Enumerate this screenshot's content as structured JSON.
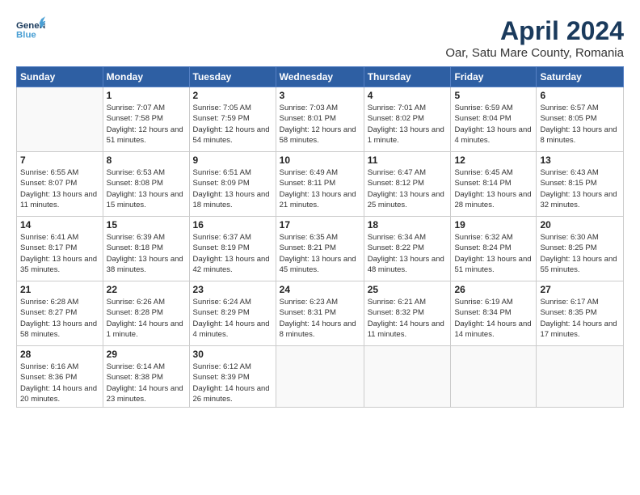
{
  "header": {
    "logo_general": "General",
    "logo_blue": "Blue",
    "title": "April 2024",
    "subtitle": "Oar, Satu Mare County, Romania"
  },
  "days_of_week": [
    "Sunday",
    "Monday",
    "Tuesday",
    "Wednesday",
    "Thursday",
    "Friday",
    "Saturday"
  ],
  "weeks": [
    [
      {
        "day": "",
        "sunrise": "",
        "sunset": "",
        "daylight": ""
      },
      {
        "day": "1",
        "sunrise": "Sunrise: 7:07 AM",
        "sunset": "Sunset: 7:58 PM",
        "daylight": "Daylight: 12 hours and 51 minutes."
      },
      {
        "day": "2",
        "sunrise": "Sunrise: 7:05 AM",
        "sunset": "Sunset: 7:59 PM",
        "daylight": "Daylight: 12 hours and 54 minutes."
      },
      {
        "day": "3",
        "sunrise": "Sunrise: 7:03 AM",
        "sunset": "Sunset: 8:01 PM",
        "daylight": "Daylight: 12 hours and 58 minutes."
      },
      {
        "day": "4",
        "sunrise": "Sunrise: 7:01 AM",
        "sunset": "Sunset: 8:02 PM",
        "daylight": "Daylight: 13 hours and 1 minute."
      },
      {
        "day": "5",
        "sunrise": "Sunrise: 6:59 AM",
        "sunset": "Sunset: 8:04 PM",
        "daylight": "Daylight: 13 hours and 4 minutes."
      },
      {
        "day": "6",
        "sunrise": "Sunrise: 6:57 AM",
        "sunset": "Sunset: 8:05 PM",
        "daylight": "Daylight: 13 hours and 8 minutes."
      }
    ],
    [
      {
        "day": "7",
        "sunrise": "Sunrise: 6:55 AM",
        "sunset": "Sunset: 8:07 PM",
        "daylight": "Daylight: 13 hours and 11 minutes."
      },
      {
        "day": "8",
        "sunrise": "Sunrise: 6:53 AM",
        "sunset": "Sunset: 8:08 PM",
        "daylight": "Daylight: 13 hours and 15 minutes."
      },
      {
        "day": "9",
        "sunrise": "Sunrise: 6:51 AM",
        "sunset": "Sunset: 8:09 PM",
        "daylight": "Daylight: 13 hours and 18 minutes."
      },
      {
        "day": "10",
        "sunrise": "Sunrise: 6:49 AM",
        "sunset": "Sunset: 8:11 PM",
        "daylight": "Daylight: 13 hours and 21 minutes."
      },
      {
        "day": "11",
        "sunrise": "Sunrise: 6:47 AM",
        "sunset": "Sunset: 8:12 PM",
        "daylight": "Daylight: 13 hours and 25 minutes."
      },
      {
        "day": "12",
        "sunrise": "Sunrise: 6:45 AM",
        "sunset": "Sunset: 8:14 PM",
        "daylight": "Daylight: 13 hours and 28 minutes."
      },
      {
        "day": "13",
        "sunrise": "Sunrise: 6:43 AM",
        "sunset": "Sunset: 8:15 PM",
        "daylight": "Daylight: 13 hours and 32 minutes."
      }
    ],
    [
      {
        "day": "14",
        "sunrise": "Sunrise: 6:41 AM",
        "sunset": "Sunset: 8:17 PM",
        "daylight": "Daylight: 13 hours and 35 minutes."
      },
      {
        "day": "15",
        "sunrise": "Sunrise: 6:39 AM",
        "sunset": "Sunset: 8:18 PM",
        "daylight": "Daylight: 13 hours and 38 minutes."
      },
      {
        "day": "16",
        "sunrise": "Sunrise: 6:37 AM",
        "sunset": "Sunset: 8:19 PM",
        "daylight": "Daylight: 13 hours and 42 minutes."
      },
      {
        "day": "17",
        "sunrise": "Sunrise: 6:35 AM",
        "sunset": "Sunset: 8:21 PM",
        "daylight": "Daylight: 13 hours and 45 minutes."
      },
      {
        "day": "18",
        "sunrise": "Sunrise: 6:34 AM",
        "sunset": "Sunset: 8:22 PM",
        "daylight": "Daylight: 13 hours and 48 minutes."
      },
      {
        "day": "19",
        "sunrise": "Sunrise: 6:32 AM",
        "sunset": "Sunset: 8:24 PM",
        "daylight": "Daylight: 13 hours and 51 minutes."
      },
      {
        "day": "20",
        "sunrise": "Sunrise: 6:30 AM",
        "sunset": "Sunset: 8:25 PM",
        "daylight": "Daylight: 13 hours and 55 minutes."
      }
    ],
    [
      {
        "day": "21",
        "sunrise": "Sunrise: 6:28 AM",
        "sunset": "Sunset: 8:27 PM",
        "daylight": "Daylight: 13 hours and 58 minutes."
      },
      {
        "day": "22",
        "sunrise": "Sunrise: 6:26 AM",
        "sunset": "Sunset: 8:28 PM",
        "daylight": "Daylight: 14 hours and 1 minute."
      },
      {
        "day": "23",
        "sunrise": "Sunrise: 6:24 AM",
        "sunset": "Sunset: 8:29 PM",
        "daylight": "Daylight: 14 hours and 4 minutes."
      },
      {
        "day": "24",
        "sunrise": "Sunrise: 6:23 AM",
        "sunset": "Sunset: 8:31 PM",
        "daylight": "Daylight: 14 hours and 8 minutes."
      },
      {
        "day": "25",
        "sunrise": "Sunrise: 6:21 AM",
        "sunset": "Sunset: 8:32 PM",
        "daylight": "Daylight: 14 hours and 11 minutes."
      },
      {
        "day": "26",
        "sunrise": "Sunrise: 6:19 AM",
        "sunset": "Sunset: 8:34 PM",
        "daylight": "Daylight: 14 hours and 14 minutes."
      },
      {
        "day": "27",
        "sunrise": "Sunrise: 6:17 AM",
        "sunset": "Sunset: 8:35 PM",
        "daylight": "Daylight: 14 hours and 17 minutes."
      }
    ],
    [
      {
        "day": "28",
        "sunrise": "Sunrise: 6:16 AM",
        "sunset": "Sunset: 8:36 PM",
        "daylight": "Daylight: 14 hours and 20 minutes."
      },
      {
        "day": "29",
        "sunrise": "Sunrise: 6:14 AM",
        "sunset": "Sunset: 8:38 PM",
        "daylight": "Daylight: 14 hours and 23 minutes."
      },
      {
        "day": "30",
        "sunrise": "Sunrise: 6:12 AM",
        "sunset": "Sunset: 8:39 PM",
        "daylight": "Daylight: 14 hours and 26 minutes."
      },
      {
        "day": "",
        "sunrise": "",
        "sunset": "",
        "daylight": ""
      },
      {
        "day": "",
        "sunrise": "",
        "sunset": "",
        "daylight": ""
      },
      {
        "day": "",
        "sunrise": "",
        "sunset": "",
        "daylight": ""
      },
      {
        "day": "",
        "sunrise": "",
        "sunset": "",
        "daylight": ""
      }
    ]
  ]
}
